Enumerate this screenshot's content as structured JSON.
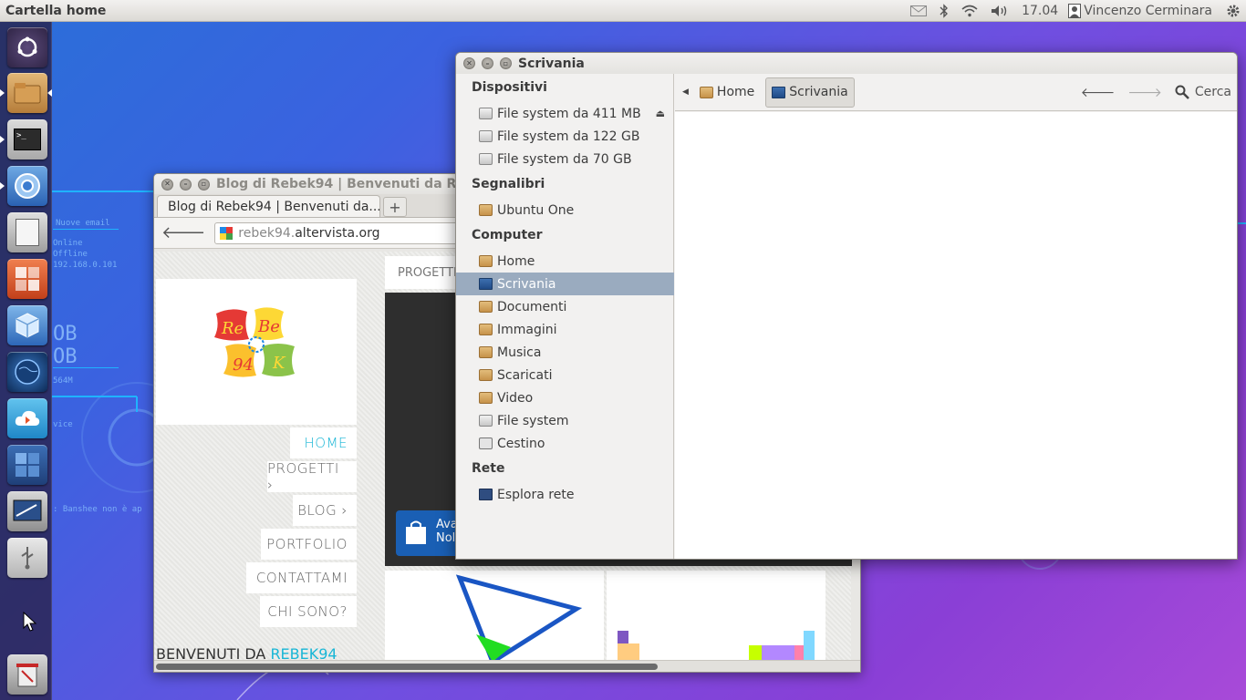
{
  "top_panel": {
    "app_title": "Cartella home",
    "clock": "17.04",
    "user_name": "Vincenzo Cerminara"
  },
  "desktop": {
    "conky_lines": [
      "Nuove email",
      "Online",
      "Offline",
      "192.168.0.101"
    ],
    "conky_storage": [
      "OB",
      "OB"
    ],
    "conky_mem": "564M",
    "conky_vice": "vice",
    "conky_banshee": ": Banshee non è ap"
  },
  "launcher": {
    "items": [
      "dash-home",
      "files",
      "terminal",
      "chromium",
      "text-editor",
      "system-settings",
      "virtualbox",
      "earth-browser",
      "cloud-sync",
      "workspace-switcher",
      "screenshot",
      "usb-drive",
      "cursor-tool",
      "trash"
    ]
  },
  "browser": {
    "window_title": "Blog di Rebek94 | Benvenuti da Rebek",
    "tab_title": "Blog di Rebek94 | Benvenuti da...",
    "new_tab": "+",
    "url_dim": "rebek94.",
    "url_host": "altervista.org",
    "page": {
      "progetti_header": "PROGETTI",
      "menu": [
        "HOME",
        "PROGETTI ›",
        "BLOG ›",
        "PORTFOLIO",
        "CONTATTAMI",
        "CHI SONO?"
      ],
      "welcome_prefix": "BENVENUTI DA ",
      "welcome_name": "REBEK94",
      "store_badge_line1": "Ava",
      "store_badge_line2": "Nol"
    }
  },
  "file_manager": {
    "window_title": "Scrivania",
    "sidebar": {
      "devices_header": "Dispositivi",
      "devices": [
        "File system da 411 MB",
        "File system da 122 GB",
        "File system da 70 GB"
      ],
      "bookmarks_header": "Segnalibri",
      "bookmarks": [
        "Ubuntu One"
      ],
      "computer_header": "Computer",
      "computer": [
        "Home",
        "Scrivania",
        "Documenti",
        "Immagini",
        "Musica",
        "Scaricati",
        "Video",
        "File system",
        "Cestino"
      ],
      "network_header": "Rete",
      "network": [
        "Esplora rete"
      ]
    },
    "breadcrumb": [
      "Home",
      "Scrivania"
    ],
    "search_label": "Cerca",
    "selected_location": "Scrivania",
    "accent": "#9aabbf"
  }
}
